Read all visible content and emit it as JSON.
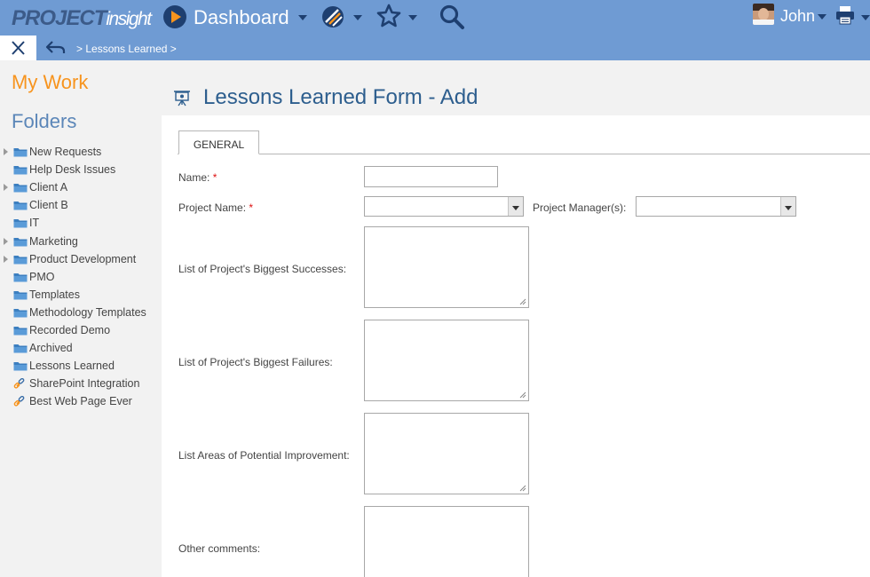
{
  "topbar": {
    "logo_part1": "PROJECT",
    "logo_part2": "insight",
    "dashboard_label": "Dashboard",
    "user_name": "John",
    "icons": [
      "dashboard-play-icon",
      "project-ball-icon",
      "favorites-star-icon",
      "search-icon",
      "user-avatar",
      "printer-icon"
    ],
    "colors": {
      "bar": "#6f9bd3",
      "dark": "#1e3f70",
      "accent": "#f7941e"
    }
  },
  "subbar": {
    "breadcrumb": "> Lessons Learned >"
  },
  "sidebar": {
    "my_work": "My Work",
    "folders_title": "Folders",
    "items": [
      {
        "label": "New Requests",
        "icon": "folder-icon",
        "expandable": true
      },
      {
        "label": "Help Desk Issues",
        "icon": "folder-icon",
        "expandable": false
      },
      {
        "label": "Client A",
        "icon": "folder-icon",
        "expandable": true
      },
      {
        "label": "Client B",
        "icon": "folder-icon",
        "expandable": false
      },
      {
        "label": "IT",
        "icon": "folder-icon",
        "expandable": false
      },
      {
        "label": "Marketing",
        "icon": "folder-icon",
        "expandable": true
      },
      {
        "label": "Product Development",
        "icon": "folder-icon",
        "expandable": true
      },
      {
        "label": "PMO",
        "icon": "folder-icon",
        "expandable": false
      },
      {
        "label": "Templates",
        "icon": "folder-icon",
        "expandable": false
      },
      {
        "label": "Methodology Templates",
        "icon": "folder-icon",
        "expandable": false
      },
      {
        "label": "Recorded Demo",
        "icon": "folder-icon",
        "expandable": false
      },
      {
        "label": "Archived",
        "icon": "folder-icon",
        "expandable": false
      },
      {
        "label": "Lessons Learned",
        "icon": "folder-icon",
        "expandable": false
      },
      {
        "label": "SharePoint Integration",
        "icon": "link-icon",
        "expandable": false
      },
      {
        "label": "Best Web Page Ever",
        "icon": "link-icon",
        "expandable": false
      }
    ]
  },
  "main": {
    "title": "Lessons Learned Form - Add",
    "tab_general": "GENERAL",
    "form": {
      "name_label": "Name:",
      "required_mark": "*",
      "project_name_label": "Project Name:",
      "project_managers_label": "Project Manager(s):",
      "successes_label": "List of Project's Biggest Successes:",
      "failures_label": "List of Project's Biggest Failures:",
      "improvement_label": "List Areas of Potential Improvement:",
      "comments_label": "Other comments:",
      "name_value": "",
      "project_name_value": "",
      "project_managers_value": ""
    }
  }
}
